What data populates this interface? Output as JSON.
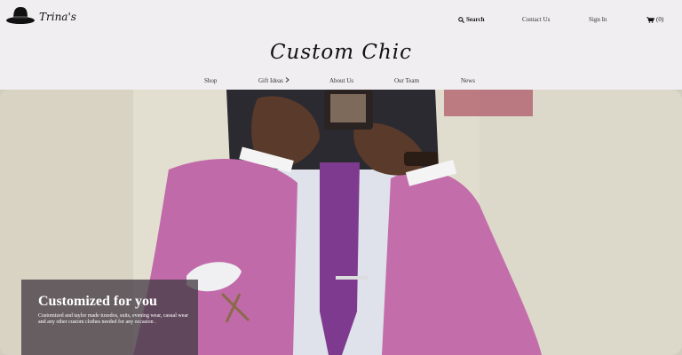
{
  "logo": {
    "text": "Trina's",
    "icon": "hat-icon"
  },
  "nav_top": {
    "search_label": "Search",
    "search_icon": "search-icon",
    "contact_label": "Contact Us",
    "signin_label": "Sign In",
    "cart_icon": "cart-icon",
    "cart_count": "(0)"
  },
  "brand_title": "Custom Chic",
  "menu": {
    "shop": "Shop",
    "gift": "Gift Ideas",
    "about": "About Us",
    "team": "Our Team",
    "news": "News"
  },
  "hero": {
    "caption_title": "Customized for you",
    "caption_text": "Customized and taylor made tuxedos, suits, evening wear, casual wear and any other custom clothes needed for any occasion ."
  }
}
